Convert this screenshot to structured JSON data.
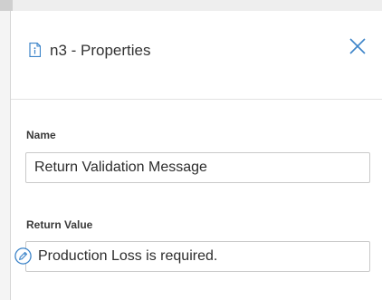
{
  "panel": {
    "title": "n3 - Properties",
    "close_icon": "close-icon",
    "header_icon": "document-info-icon"
  },
  "fields": {
    "name": {
      "label": "Name",
      "value": "Return Validation Message"
    },
    "return_value": {
      "label": "Return Value",
      "value": "Production Loss is required.",
      "icon": "pencil-edit-icon"
    }
  },
  "colors": {
    "accent": "#3c84c9",
    "text": "#333333",
    "border": "#c9c9c9"
  }
}
